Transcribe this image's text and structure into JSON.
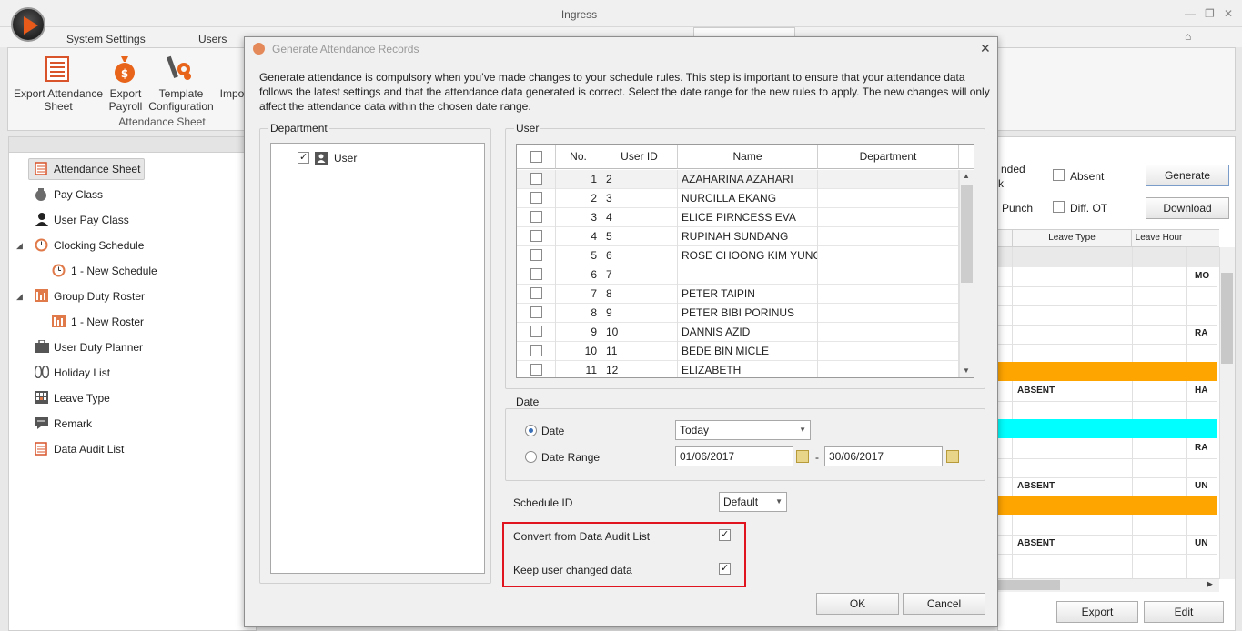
{
  "window": {
    "title": "Ingress",
    "min": "—",
    "restore": "❐",
    "close": "✕",
    "help": "⌂"
  },
  "ribbon_tabs": [
    "System Settings",
    "Users"
  ],
  "ribbon": {
    "buttons": [
      {
        "label": "Export Attendance Sheet"
      },
      {
        "label": "Export Payroll"
      },
      {
        "label": "Template Configuration"
      },
      {
        "label": "Impo"
      }
    ],
    "group_label": "Attendance Sheet"
  },
  "nav": [
    {
      "label": "Attendance Sheet"
    },
    {
      "label": "Pay Class"
    },
    {
      "label": "User Pay Class"
    },
    {
      "label": "Clocking Schedule"
    },
    {
      "label": "1 - New Schedule"
    },
    {
      "label": "Group Duty Roster"
    },
    {
      "label": "1 - New Roster"
    },
    {
      "label": "User Duty Planner"
    },
    {
      "label": "Holiday List"
    },
    {
      "label": "Leave Type"
    },
    {
      "label": "Remark"
    },
    {
      "label": "Data Audit List"
    }
  ],
  "right": {
    "frag1": "nded",
    "frag2": "k",
    "frag3": "Punch",
    "absent_label": "Absent",
    "diffot_label": "Diff. OT",
    "generate": "Generate",
    "download": "Download",
    "col_leave_type": "Leave Type",
    "col_leave_hour": "Leave Hour",
    "rows": [
      "MO",
      "RA",
      "HA",
      "RA",
      "UN",
      "UN"
    ],
    "absent_cells": [
      "ABSENT",
      "ABSENT",
      "ABSENT"
    ],
    "colors": {
      "orange": "#ffa500",
      "cyan": "#00ffff"
    },
    "export": "Export",
    "edit": "Edit"
  },
  "dialog": {
    "title": "Generate Attendance Records",
    "close": "✕",
    "description": "Generate attendance is compulsory when you’ve made changes to your schedule rules. This step is important to ensure that your attendance data follows the latest settings and that the attendance data generated is correct. Select the date range for the new rules to apply. The new changes will only affect the attendance data within the chosen date range.",
    "department_label": "Department",
    "dept_tree_item": "User",
    "user_label": "User",
    "columns": [
      "No.",
      "User ID",
      "Name",
      "Department"
    ],
    "users": [
      {
        "no": "1",
        "id": "2",
        "name": "AZAHARINA AZAHARI",
        "dept": ""
      },
      {
        "no": "2",
        "id": "3",
        "name": "NURCILLA EKANG",
        "dept": ""
      },
      {
        "no": "3",
        "id": "4",
        "name": "ELICE PIRNCESS EVA",
        "dept": ""
      },
      {
        "no": "4",
        "id": "5",
        "name": "RUPINAH SUNDANG",
        "dept": ""
      },
      {
        "no": "5",
        "id": "6",
        "name": "ROSE CHOONG KIM YUNG",
        "dept": ""
      },
      {
        "no": "6",
        "id": "7",
        "name": "",
        "dept": ""
      },
      {
        "no": "7",
        "id": "8",
        "name": "PETER TAIPIN",
        "dept": ""
      },
      {
        "no": "8",
        "id": "9",
        "name": "PETER BIBI PORINUS",
        "dept": ""
      },
      {
        "no": "9",
        "id": "10",
        "name": "DANNIS AZID",
        "dept": ""
      },
      {
        "no": "10",
        "id": "11",
        "name": "BEDE BIN MICLE",
        "dept": ""
      },
      {
        "no": "11",
        "id": "12",
        "name": "ELIZABETH",
        "dept": ""
      }
    ],
    "date_group_label": "Date",
    "date_option": "Date",
    "date_value": "Today",
    "range_option": "Date Range",
    "range_from": "01/06/2017",
    "range_sep": "-",
    "range_to": "30/06/2017",
    "schedule_id_label": "Schedule ID",
    "schedule_id_value": "Default",
    "convert_label": "Convert from Data Audit List",
    "keep_label": "Keep user changed data",
    "ok": "OK",
    "cancel": "Cancel"
  }
}
